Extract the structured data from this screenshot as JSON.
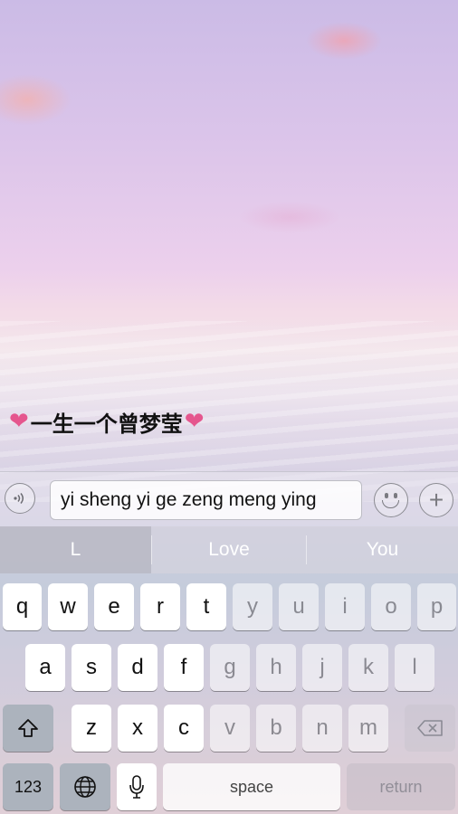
{
  "post": {
    "heart_left": "❤",
    "title_text": "一生一个曾梦莹",
    "heart_right": "❤"
  },
  "input_bar": {
    "text_value": "yi sheng yi ge zeng meng ying"
  },
  "suggestions": [
    "L",
    "Love",
    "You"
  ],
  "keyboard": {
    "row1": [
      "q",
      "w",
      "e",
      "r",
      "t",
      "y",
      "u",
      "i",
      "o",
      "p"
    ],
    "row2": [
      "a",
      "s",
      "d",
      "f",
      "g",
      "h",
      "j",
      "k",
      "l"
    ],
    "row3": [
      "z",
      "x",
      "c",
      "v",
      "b",
      "n",
      "m"
    ],
    "numbers_label": "123",
    "space_label": "space",
    "return_label": "return"
  },
  "colors": {
    "heart": "#e5568e",
    "text_dark": "#111111"
  }
}
